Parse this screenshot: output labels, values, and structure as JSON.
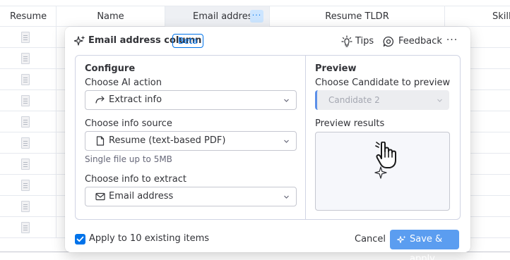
{
  "table": {
    "columns": [
      "Resume",
      "Name",
      "Email address",
      "Resume TLDR",
      "Skill"
    ],
    "column_menu_label": "···",
    "row_count": 10
  },
  "modal": {
    "title": "Email address column",
    "badge": "Beta",
    "tips_label": "Tips",
    "feedback_label": "Feedback",
    "more_label": "···",
    "configure": {
      "section_title": "Configure",
      "ai_action_label": "Choose AI action",
      "ai_action_value": "Extract info",
      "info_source_label": "Choose info source",
      "info_source_value": "Resume (text-based PDF)",
      "info_source_hint": "Single file up to 5MB",
      "info_extract_label": "Choose info to extract",
      "info_extract_value": "Email address"
    },
    "preview": {
      "section_title": "Preview",
      "candidate_label": "Choose Candidate to preview",
      "candidate_value": "Candidate 2",
      "results_label": "Preview results"
    },
    "footer": {
      "apply_label": "Apply to 10 existing items",
      "apply_checked": true,
      "cancel_label": "Cancel",
      "save_label": "Save & apply"
    }
  },
  "colors": {
    "accent": "#0073ea",
    "save_button": "#5b9df0",
    "header_highlight": "#eef0f4"
  },
  "icons": [
    "sparkle-icon",
    "lightbulb-icon",
    "feedback-icon",
    "arrow-icon",
    "file-icon",
    "mail-icon",
    "chevron-down-icon",
    "hand-cursor-icon",
    "checkmark-icon"
  ]
}
